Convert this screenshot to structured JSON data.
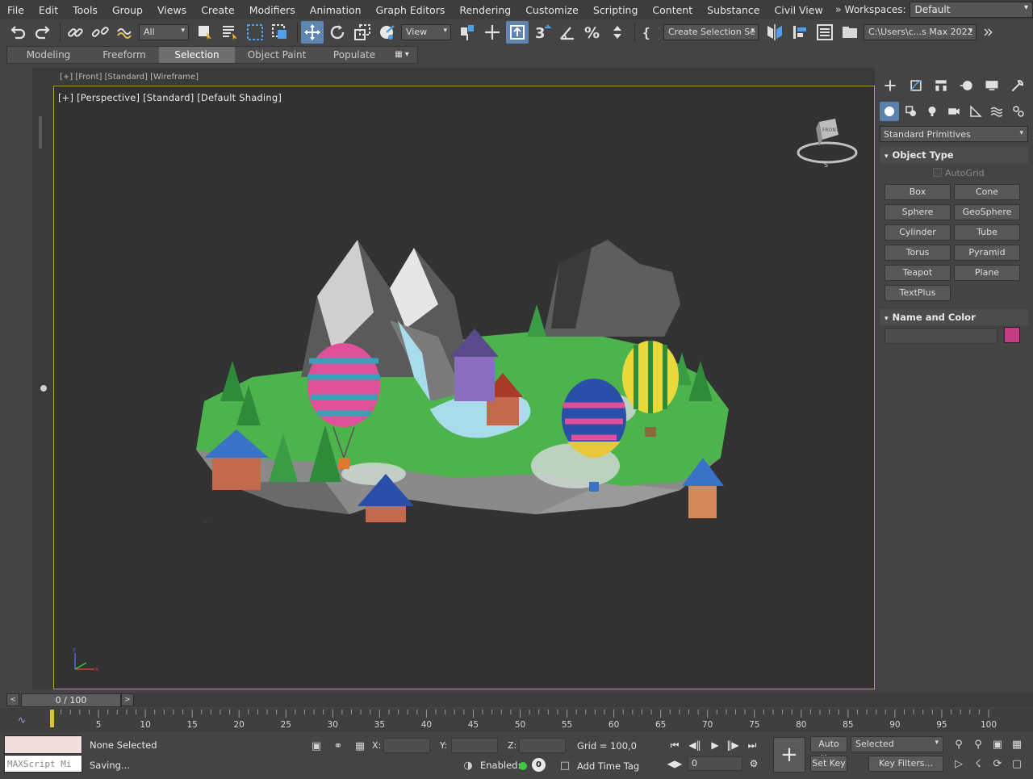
{
  "menu": {
    "items": [
      "File",
      "Edit",
      "Tools",
      "Group",
      "Views",
      "Create",
      "Modifiers",
      "Animation",
      "Graph Editors",
      "Rendering",
      "Customize",
      "Scripting",
      "Content",
      "Substance",
      "Civil View"
    ],
    "overflow_icon": "double-chevron-right-icon",
    "workspaces_label": "Workspaces:",
    "workspaces_value": "Default"
  },
  "toolbar": {
    "selection_filter": "All",
    "ref_coord": "View",
    "named_selection": "Create Selection Se",
    "project_path": "C:\\Users\\c...s Max 2022"
  },
  "ribbon": {
    "tabs": [
      "Modeling",
      "Freeform",
      "Selection",
      "Object Paint",
      "Populate"
    ],
    "selected_tab": "Selection"
  },
  "viewport": {
    "top_strip_label": "[+] [Front] [Standard] [Wireframe]",
    "label": "[+] [Perspective] [Standard] [Default Shading]",
    "viewcube_face": "FRONT",
    "scene_description_icon": "floating-island-scene"
  },
  "command_panel": {
    "tab_icons": [
      "create-icon",
      "modify-icon",
      "hierarchy-icon",
      "motion-icon",
      "display-icon",
      "utilities-icon"
    ],
    "sub_icons": [
      "geometry-icon",
      "shapes-icon",
      "lights-icon",
      "cameras-icon",
      "helpers-icon",
      "space-warps-icon",
      "systems-icon"
    ],
    "category": "Standard Primitives",
    "object_type_title": "Object Type",
    "autogrid_label": "AutoGrid",
    "primitives": [
      "Box",
      "Cone",
      "Sphere",
      "GeoSphere",
      "Cylinder",
      "Tube",
      "Torus",
      "Pyramid",
      "Teapot",
      "Plane",
      "TextPlus"
    ],
    "name_color_title": "Name and Color",
    "object_color": "#c43c86"
  },
  "time_slider": {
    "value": "0 / 100",
    "ticks": [
      "5",
      "10",
      "15",
      "20",
      "25",
      "30",
      "35",
      "40",
      "45",
      "50",
      "55",
      "60",
      "65",
      "70",
      "75",
      "80",
      "85",
      "90",
      "95",
      "100"
    ]
  },
  "status": {
    "maxscript_placeholder": "MAXScript Mi",
    "selection_text": "None Selected",
    "prompt_text": "Saving...",
    "x_label": "X:",
    "y_label": "Y:",
    "z_label": "Z:",
    "grid_text": "Grid = 100,0",
    "enabled_label": "Enabled:",
    "enabled_value": "0",
    "add_time_tag": "Add Time Tag",
    "frame_value": "0",
    "auto_key": "Auto Key",
    "set_key": "Set Key",
    "key_selected": "Selected",
    "key_filters": "Key Filters..."
  },
  "colors": {
    "accent": "#5f86b3",
    "viewport_border": "#c59b3a",
    "enabled_dot": "#3ecb3e"
  }
}
